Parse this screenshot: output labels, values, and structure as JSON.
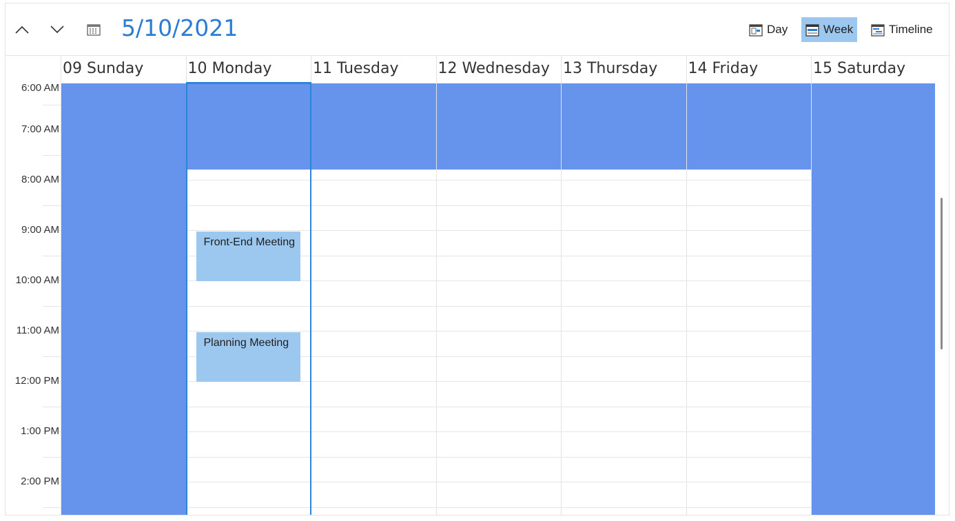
{
  "toolbar": {
    "date": "5/10/2021",
    "views": [
      {
        "label": "Day",
        "active": false
      },
      {
        "label": "Week",
        "active": true
      },
      {
        "label": "Timeline",
        "active": false
      }
    ]
  },
  "days": [
    {
      "label": "09 Sunday",
      "workday": false
    },
    {
      "label": "10 Monday",
      "workday": true,
      "selected": true
    },
    {
      "label": "11 Tuesday",
      "workday": true
    },
    {
      "label": "12 Wednesday",
      "workday": true
    },
    {
      "label": "13 Thursday",
      "workday": true
    },
    {
      "label": "14 Friday",
      "workday": true
    },
    {
      "label": "15 Saturday",
      "workday": false
    }
  ],
  "times": [
    "6:00 AM",
    "7:00 AM",
    "8:00 AM",
    "9:00 AM",
    "10:00 AM",
    "11:00 AM",
    "12:00 PM",
    "1:00 PM",
    "2:00 PM"
  ],
  "work_start_hour": 7.8,
  "appointments": [
    {
      "title": "Front-End Meeting",
      "day": 1,
      "start": 9.0,
      "end": 10.0
    },
    {
      "title": "Planning Meeting",
      "day": 1,
      "start": 11.0,
      "end": 12.0
    }
  ],
  "colors": {
    "accent": "#2b7cd3",
    "nonworking": "#6694ec",
    "appointment": "#9cc8ef",
    "selected_border": "#2b86d9"
  }
}
